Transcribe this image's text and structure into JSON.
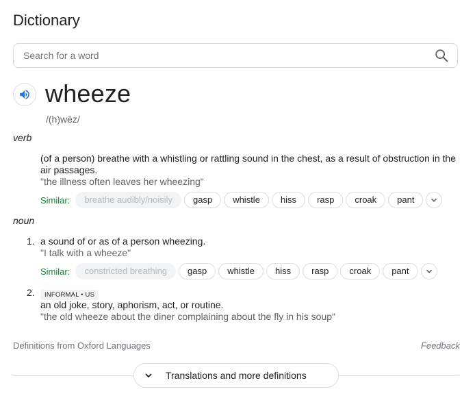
{
  "heading": "Dictionary",
  "search": {
    "placeholder": "Search for a word"
  },
  "entry": {
    "word": "wheeze",
    "phonetic": "/(h)wēz/",
    "verb": {
      "pos": "verb",
      "definition_line1": "(of a person) breathe with a whistling or rattling sound in the chest, as a result of obstruction in the",
      "definition_line2": "air passages.",
      "example": "\"the illness often leaves her wheezing\"",
      "similar_label": "Similar:",
      "similar": [
        "breathe audibly/noisily",
        "gasp",
        "whistle",
        "hiss",
        "rasp",
        "croak",
        "pant"
      ]
    },
    "noun": {
      "pos": "noun",
      "senses": [
        {
          "number": "1.",
          "definition": "a sound of or as of a person wheezing.",
          "example": "\"I talk with a wheeze\"",
          "similar_label": "Similar:",
          "similar": [
            "constricted breathing",
            "gasp",
            "whistle",
            "hiss",
            "rasp",
            "croak",
            "pant"
          ]
        },
        {
          "number": "2.",
          "label": "INFORMAL • US",
          "definition": "an old joke, story, aphorism, act, or routine.",
          "example": "\"the old wheeze about the diner complaining about the fly in his soup\""
        }
      ]
    }
  },
  "footer": {
    "source": "Definitions from Oxford Languages",
    "feedback": "Feedback",
    "more_button": "Translations and more definitions"
  },
  "icons": {
    "search": "search-icon",
    "speaker": "speaker-icon",
    "expand": "chevron-down-icon"
  },
  "colors": {
    "similar_label": "#188038",
    "accent": "#1a73e8",
    "border": "#dadce0"
  }
}
